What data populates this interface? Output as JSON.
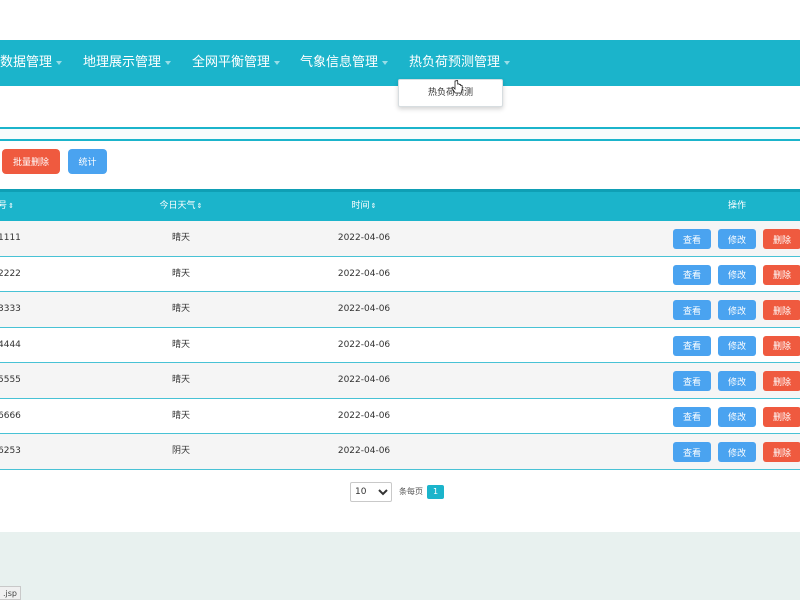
{
  "nav": {
    "items": [
      {
        "label": "数据管理"
      },
      {
        "label": "地理展示管理"
      },
      {
        "label": "全网平衡管理"
      },
      {
        "label": "气象信息管理"
      },
      {
        "label": "热负荷预测管理"
      }
    ],
    "dropdown": {
      "item": "热负荷预测"
    }
  },
  "toolbar": {
    "batch_delete": "批量删除",
    "stats": "统计"
  },
  "table": {
    "headers": {
      "id": "号",
      "weather": "今日天气",
      "time": "时间",
      "ops": "操作"
    },
    "sort_glyph": "⇕",
    "rows": [
      {
        "id": "1111",
        "weather": "晴天",
        "time": "2022-04-06"
      },
      {
        "id": "2222",
        "weather": "晴天",
        "time": "2022-04-06"
      },
      {
        "id": "3333",
        "weather": "晴天",
        "time": "2022-04-06"
      },
      {
        "id": "4444",
        "weather": "晴天",
        "time": "2022-04-06"
      },
      {
        "id": "5555",
        "weather": "晴天",
        "time": "2022-04-06"
      },
      {
        "id": "6666",
        "weather": "晴天",
        "time": "2022-04-06"
      },
      {
        "id": "6253",
        "weather": "阴天",
        "time": "2022-04-06"
      }
    ],
    "actions": {
      "view": "查看",
      "edit": "修改",
      "delete": "删除"
    }
  },
  "pagination": {
    "page_size": "10",
    "page_size_options": [
      "10"
    ],
    "per_page_label": "条每页",
    "current_page": "1"
  },
  "status_bar": {
    "url": ".jsp"
  },
  "colors": {
    "primary": "#1bb4cb",
    "danger": "#ef5a3f",
    "info": "#4aa3f0"
  }
}
